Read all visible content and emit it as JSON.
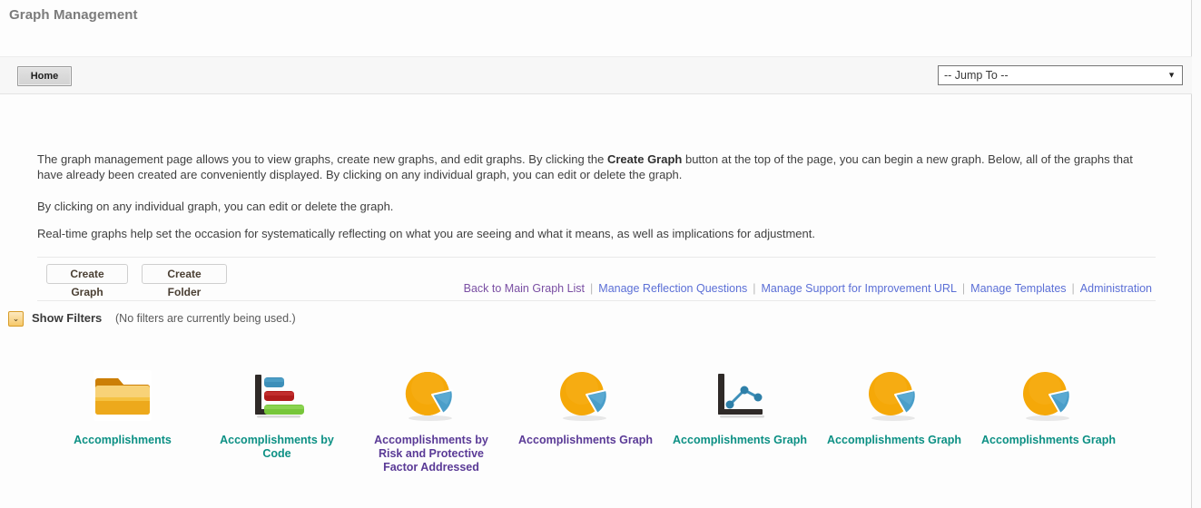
{
  "header": {
    "title": "Graph Management"
  },
  "toolbar": {
    "home_label": "Home",
    "jump_to_value": "-- Jump To --",
    "caret_icon": "chevron-down-icon"
  },
  "intro": {
    "paragraph_1_before": "The graph management page allows you to view graphs, create new graphs, and edit graphs. By clicking the ",
    "paragraph_1_bold": "Create Graph",
    "paragraph_1_after": " button at the top of the page, you can begin a new graph. Below, all of the graphs that have already been created are conveniently displayed. By clicking on any individual graph, you can edit or delete the graph.",
    "paragraph_2": "By clicking on any individual graph, you can edit or delete the graph.",
    "paragraph_3": "Real-time graphs help set the occasion for systematically reflecting on what you are seeing and what it means, as well as implications for adjustment."
  },
  "actions": {
    "create_graph_label": "Create Graph",
    "create_folder_label": "Create Folder"
  },
  "links": [
    {
      "label": "Back to Main Graph List",
      "visited": true
    },
    {
      "label": "Manage Reflection Questions",
      "visited": false
    },
    {
      "label": "Manage Support for Improvement URL",
      "visited": false
    },
    {
      "label": "Manage Templates",
      "visited": false
    },
    {
      "label": "Administration",
      "visited": false
    }
  ],
  "link_separator": "|",
  "filters": {
    "toggle_icon": "chevron-down-icon",
    "toggle_glyph": "⌄",
    "label": "Show Filters",
    "note": "(No filters are currently being used.)"
  },
  "graph_items": [
    {
      "label": "Accomplishments",
      "icon": "folder-icon",
      "color": "teal"
    },
    {
      "label": "Accomplishments by Code",
      "icon": "bar-chart-icon",
      "color": "teal"
    },
    {
      "label": "Accomplishments by Risk and Protective Factor Addressed",
      "icon": "pie-chart-icon",
      "color": "purple"
    },
    {
      "label": "Accomplishments Graph",
      "icon": "pie-chart-icon",
      "color": "purple"
    },
    {
      "label": "Accomplishments Graph",
      "icon": "line-chart-icon",
      "color": "teal"
    },
    {
      "label": "Accomplishments Graph",
      "icon": "pie-chart-icon",
      "color": "teal"
    },
    {
      "label": "Accomplishments Graph",
      "icon": "pie-chart-icon",
      "color": "teal"
    }
  ],
  "colors": {
    "title_gray": "#7b7b7b",
    "link_blue": "#5b6fd6",
    "link_visited_purple": "#7a4fa3",
    "label_teal": "#0c9084",
    "label_purple": "#5a3a96",
    "folder_orange": "#f0a81e",
    "pie_orange": "#f5a808",
    "pie_blue": "#4a9ec9",
    "bar_blue": "#3d8fb9",
    "bar_red": "#b01c1c",
    "bar_green": "#77c63a",
    "axis_dark": "#2f2a28",
    "filter_toggle_orange": "#f6c96a"
  }
}
